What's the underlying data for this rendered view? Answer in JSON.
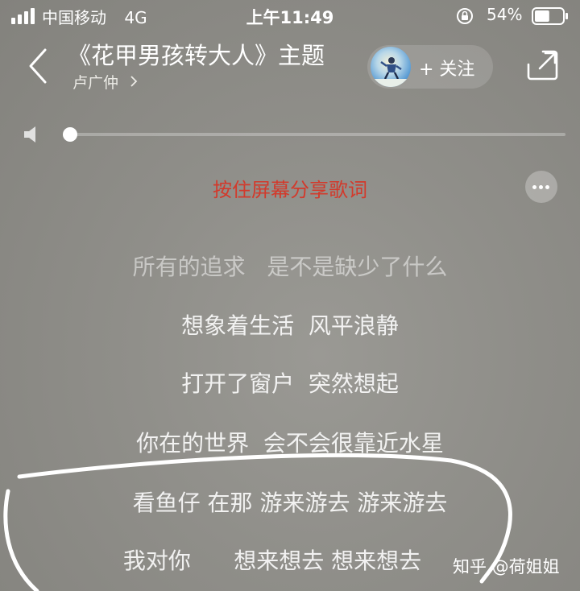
{
  "status_bar": {
    "carrier": "中国移动",
    "network": "4G",
    "time": "上午11:49",
    "battery_percent": "54%",
    "battery_level": 0.54
  },
  "header": {
    "title": "《花甲男孩转大人》主题",
    "artist": "卢广仲",
    "follow_label": "+ 关注"
  },
  "player": {
    "progress": 0.0
  },
  "share_hint": "按住屏幕分享歌词",
  "lyrics": [
    {
      "text": "所有的追求   是不是缺少了什么",
      "faded": true
    },
    {
      "text": "想象着生活  风平浪静",
      "faded": false
    },
    {
      "text": "打开了窗户  突然想起",
      "faded": false
    },
    {
      "text": "你在的世界  会不会很靠近水星",
      "faded": false
    },
    {
      "text": "看鱼仔 在那 游来游去 游来游去",
      "faded": false
    },
    {
      "text": "我对你      想来想去 想来想去",
      "faded": false
    }
  ],
  "watermark": "知乎 @荷姐姐",
  "colors": {
    "accent_red": "#d23a2c",
    "annotation_stroke": "#ffffff"
  }
}
